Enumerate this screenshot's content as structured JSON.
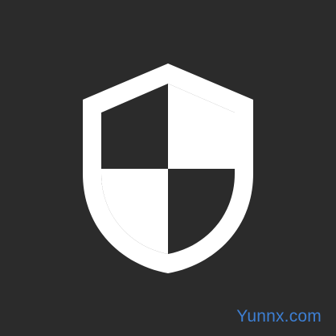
{
  "icon": {
    "name": "shield-icon",
    "fill_color": "#ffffff",
    "background_color": "#2b2b2b"
  },
  "watermark": {
    "text": "Yunnx.com",
    "color": "#3d7fd3"
  }
}
